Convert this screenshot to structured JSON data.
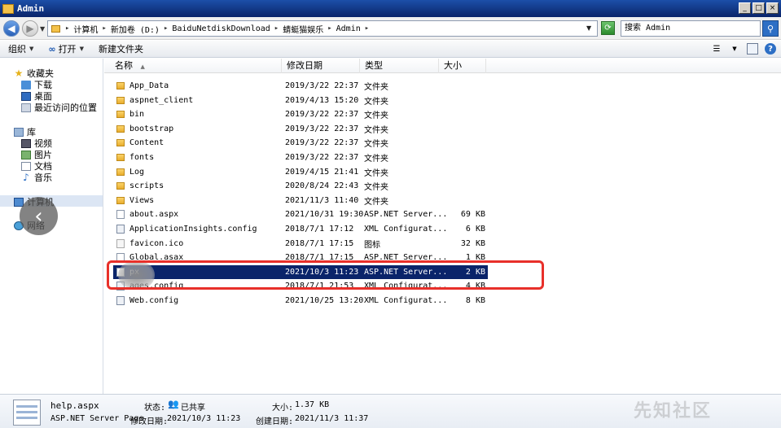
{
  "window": {
    "title": "Admin",
    "min": "_",
    "max": "□",
    "close": "×"
  },
  "address": {
    "crumbs": [
      "计算机",
      "新加卷 (D:)",
      "BaiduNetdiskDownload",
      "蜻蜓猫娱乐",
      "Admin"
    ],
    "search_placeholder": "搜索 Admin"
  },
  "toolbar": {
    "organize": "组织",
    "open": "打开",
    "new_folder": "新建文件夹"
  },
  "nav": {
    "favorites": "收藏夹",
    "downloads": "下载",
    "desktop": "桌面",
    "recent": "最近访问的位置",
    "libraries": "库",
    "videos": "视频",
    "pictures": "图片",
    "documents": "文档",
    "music": "音乐",
    "computer": "计算机",
    "network": "网络"
  },
  "columns": {
    "name": "名称",
    "date": "修改日期",
    "type": "类型",
    "size": "大小"
  },
  "files": [
    {
      "name": "App_Data",
      "date": "2019/3/22 22:37",
      "type": "文件夹",
      "size": "",
      "kind": "folder"
    },
    {
      "name": "aspnet_client",
      "date": "2019/4/13 15:20",
      "type": "文件夹",
      "size": "",
      "kind": "folder"
    },
    {
      "name": "bin",
      "date": "2019/3/22 22:37",
      "type": "文件夹",
      "size": "",
      "kind": "folder"
    },
    {
      "name": "bootstrap",
      "date": "2019/3/22 22:37",
      "type": "文件夹",
      "size": "",
      "kind": "folder"
    },
    {
      "name": "Content",
      "date": "2019/3/22 22:37",
      "type": "文件夹",
      "size": "",
      "kind": "folder"
    },
    {
      "name": "fonts",
      "date": "2019/3/22 22:37",
      "type": "文件夹",
      "size": "",
      "kind": "folder"
    },
    {
      "name": "Log",
      "date": "2019/4/15 21:41",
      "type": "文件夹",
      "size": "",
      "kind": "folder"
    },
    {
      "name": "scripts",
      "date": "2020/8/24 22:43",
      "type": "文件夹",
      "size": "",
      "kind": "folder"
    },
    {
      "name": "Views",
      "date": "2021/11/3 11:40",
      "type": "文件夹",
      "size": "",
      "kind": "folder"
    },
    {
      "name": "about.aspx",
      "date": "2021/10/31 19:30",
      "type": "ASP.NET Server...",
      "size": "69 KB",
      "kind": "file"
    },
    {
      "name": "ApplicationInsights.config",
      "date": "2018/7/1 17:12",
      "type": "XML Configurat...",
      "size": "6 KB",
      "kind": "config"
    },
    {
      "name": "favicon.ico",
      "date": "2018/7/1 17:15",
      "type": "图标",
      "size": "32 KB",
      "kind": "ico"
    },
    {
      "name": "Global.asax",
      "date": "2018/7/1 17:15",
      "type": "ASP.NET Server...",
      "size": "1 KB",
      "kind": "file"
    },
    {
      "name": "px",
      "date": "2021/10/3 11:23",
      "type": "ASP.NET Server...",
      "size": "2 KB",
      "kind": "file",
      "selected": true
    },
    {
      "name": "ages.config",
      "date": "2018/7/1 21:53",
      "type": "XML Configurat...",
      "size": "4 KB",
      "kind": "config"
    },
    {
      "name": "Web.config",
      "date": "2021/10/25 13:20",
      "type": "XML Configurat...",
      "size": "8 KB",
      "kind": "config"
    }
  ],
  "details": {
    "filename": "help.aspx",
    "filetype": "ASP.NET Server Page",
    "state_label": "状态:",
    "state_value": "已共享",
    "modified_label": "修改日期:",
    "modified_value": "2021/10/3 11:23",
    "size_label": "大小:",
    "size_value": "1.37 KB",
    "created_label": "创建日期:",
    "created_value": "2021/11/3 11:37"
  },
  "watermark": "先知社区",
  "colors": {
    "selection": "#0a246a",
    "highlight": "#e8302a",
    "titlebar": "#0a246a"
  }
}
